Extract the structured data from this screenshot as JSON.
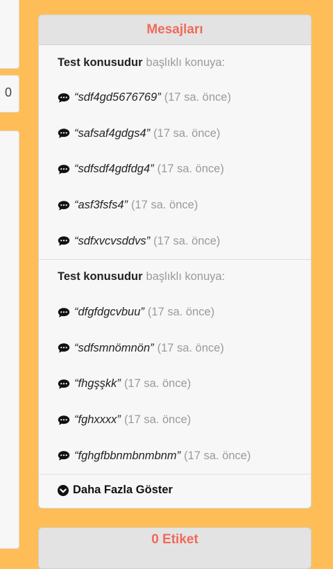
{
  "left": {
    "number": "0"
  },
  "panel": {
    "title": "Mesajları",
    "groups": [
      {
        "topic": "Test konusudur",
        "suffix": "başlıklı konuya:",
        "messages": [
          {
            "text": "“sdf4gd5676769”",
            "time": "(17 sa. önce)"
          },
          {
            "text": "“safsaf4gdgs4”",
            "time": "(17 sa. önce)"
          },
          {
            "text": "“sdfsdf4gdfdg4”",
            "time": "(17 sa. önce)"
          },
          {
            "text": "“asf3fsfs4”",
            "time": "(17 sa. önce)"
          },
          {
            "text": "“sdfxvcvsddvs”",
            "time": "(17 sa. önce)"
          }
        ]
      },
      {
        "topic": "Test konusudur",
        "suffix": "başlıklı konuya:",
        "messages": [
          {
            "text": "“dfgfdgcvbuu”",
            "time": "(17 sa. önce)"
          },
          {
            "text": "“sdfsmnömnön”",
            "time": "(17 sa. önce)"
          },
          {
            "text": "“fhgşşkk”",
            "time": "(17 sa. önce)"
          },
          {
            "text": "“fghxxxx”",
            "time": "(17 sa. önce)"
          },
          {
            "text": "“fghgfbbnmbnmbnm”",
            "time": "(17 sa. önce)"
          }
        ]
      }
    ],
    "more_label": "Daha Fazla Göster"
  },
  "next_panel": {
    "title": "0 Etiket"
  },
  "colors": {
    "background": "#ffbd57",
    "title": "#f06a5b"
  },
  "icons": {
    "message": "comment-icon",
    "more": "chevron-circle-down-icon"
  }
}
